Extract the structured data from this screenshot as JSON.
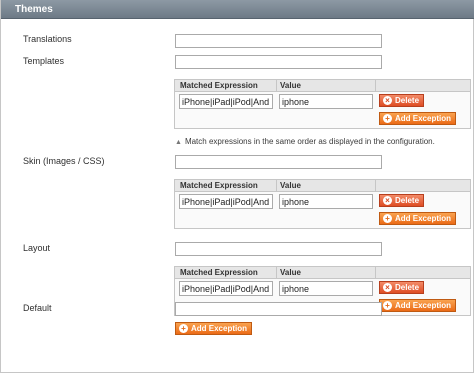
{
  "section": {
    "title": "Themes"
  },
  "fields": {
    "translations": {
      "label": "Translations",
      "value": ""
    },
    "templates": {
      "label": "Templates",
      "value": ""
    },
    "skin": {
      "label": "Skin (Images / CSS)",
      "value": ""
    },
    "layout": {
      "label": "Layout",
      "value": ""
    },
    "default": {
      "label": "Default",
      "value": ""
    }
  },
  "grid": {
    "col_expression": "Matched Expression",
    "col_value": "Value",
    "delete_label": "Delete",
    "add_label": "Add Exception"
  },
  "exceptions": {
    "templates": {
      "expression": "iPhone|iPad|iPod|And",
      "value": "iphone"
    },
    "skin": {
      "expression": "iPhone|iPad|iPod|And",
      "value": "iphone"
    },
    "layout": {
      "expression": "iPhone|iPad|iPod|And",
      "value": "iphone"
    }
  },
  "note": "Match expressions in the same order as displayed in the configuration.",
  "colors": {
    "header": "#7a8691",
    "button": "#eb6b17"
  },
  "icons": {
    "add": "plus-circle-icon",
    "delete": "x-circle-icon",
    "note": "triangle-up-icon"
  }
}
